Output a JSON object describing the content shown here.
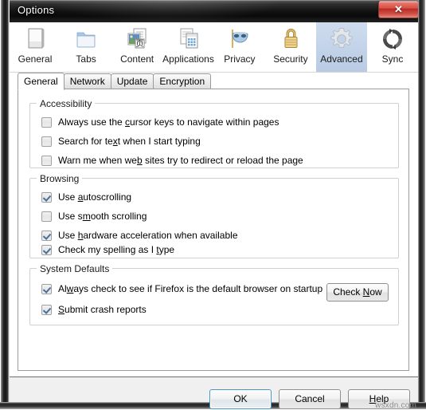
{
  "window": {
    "title": "Options",
    "close_label": "✕"
  },
  "toolbar": {
    "items": [
      {
        "label": "General",
        "icon": "document-icon",
        "selected": false
      },
      {
        "label": "Tabs",
        "icon": "folder-icon",
        "selected": false
      },
      {
        "label": "Content",
        "icon": "content-pages-icon",
        "selected": false
      },
      {
        "label": "Applications",
        "icon": "applications-icon",
        "selected": false
      },
      {
        "label": "Privacy",
        "icon": "mask-icon",
        "selected": false
      },
      {
        "label": "Security",
        "icon": "padlock-icon",
        "selected": false
      },
      {
        "label": "Advanced",
        "icon": "gear-icon",
        "selected": true
      },
      {
        "label": "Sync",
        "icon": "sync-arrows-icon",
        "selected": false
      }
    ],
    "selected_background": "#c2d2e8"
  },
  "tabs": [
    {
      "label": "General",
      "active": true
    },
    {
      "label": "Network",
      "active": false
    },
    {
      "label": "Update",
      "active": false
    },
    {
      "label": "Encryption",
      "active": false
    }
  ],
  "groups": {
    "accessibility": {
      "legend": "Accessibility",
      "options": [
        {
          "pre": "Always use the ",
          "accel": "c",
          "post": "ursor keys to navigate within pages",
          "checked": false
        },
        {
          "pre": "Search for te",
          "accel": "x",
          "post": "t when I start typing",
          "checked": false
        },
        {
          "pre": "Warn me when we",
          "accel": "b",
          "post": " sites try to redirect or reload the page",
          "checked": false
        }
      ]
    },
    "browsing": {
      "legend": "Browsing",
      "options": [
        {
          "pre": "Use ",
          "accel": "a",
          "post": "utoscrolling",
          "checked": true
        },
        {
          "pre": "Use s",
          "accel": "m",
          "post": "ooth scrolling",
          "checked": false
        },
        {
          "pre": "Use ",
          "accel": "h",
          "post": "ardware acceleration when available",
          "checked": true
        },
        {
          "pre": "Check my spelling as I ",
          "accel": "t",
          "post": "ype",
          "checked": true
        }
      ]
    },
    "system_defaults": {
      "legend": "System Defaults",
      "options": [
        {
          "pre": "Al",
          "accel": "w",
          "post": "ays check to see if Firefox is the default browser on startup",
          "checked": true
        },
        {
          "pre": "",
          "accel": "S",
          "post": "ubmit crash reports",
          "checked": true
        }
      ],
      "check_now_button": {
        "pre": "Check ",
        "accel": "N",
        "post": "ow"
      }
    }
  },
  "footer": {
    "buttons": [
      {
        "pre": "OK",
        "accel": "",
        "post": "",
        "default": true
      },
      {
        "pre": "Cancel",
        "accel": "",
        "post": "",
        "default": false
      },
      {
        "pre": "",
        "accel": "H",
        "post": "elp",
        "default": false
      }
    ]
  },
  "watermark": "wsxdn.com"
}
